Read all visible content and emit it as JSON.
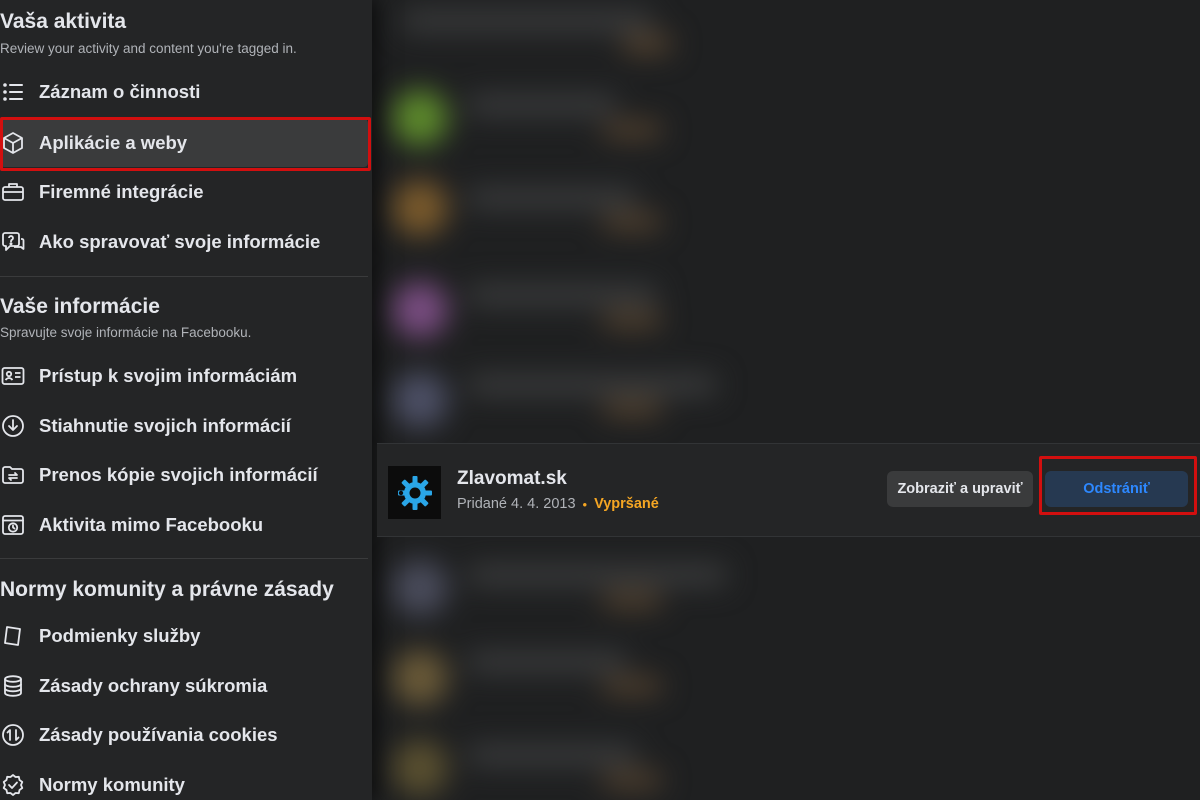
{
  "sidebar": {
    "activity": {
      "title": "Vaša aktivita",
      "subtitle": "Review your activity and content you're tagged in.",
      "items": [
        {
          "label": "Záznam o činnosti",
          "icon": "list-icon"
        },
        {
          "label": "Aplikácie a weby",
          "icon": "cube-icon",
          "selected": true
        },
        {
          "label": "Firemné integrácie",
          "icon": "briefcase-icon"
        },
        {
          "label": "Ako spravovať svoje informácie",
          "icon": "help-bubble-icon"
        }
      ]
    },
    "info": {
      "title": "Vaše informácie",
      "subtitle": "Spravujte svoje informácie na Facebooku.",
      "items": [
        {
          "label": "Prístup k svojim informáciám",
          "icon": "id-card-icon"
        },
        {
          "label": "Stiahnutie svojich informácií",
          "icon": "download-icon"
        },
        {
          "label": "Prenos kópie svojich informácií",
          "icon": "folder-transfer-icon"
        },
        {
          "label": "Aktivita mimo Facebooku",
          "icon": "history-window-icon"
        }
      ]
    },
    "community": {
      "title": "Normy komunity a právne zásady",
      "items": [
        {
          "label": "Podmienky služby",
          "icon": "document-icon"
        },
        {
          "label": "Zásady ochrany súkromia",
          "icon": "database-icon"
        },
        {
          "label": "Zásady používania cookies",
          "icon": "sync-arrows-icon"
        },
        {
          "label": "Normy komunity",
          "icon": "badge-check-icon"
        }
      ]
    }
  },
  "app": {
    "name": "Zlavomat.sk",
    "added": "Pridané 4. 4. 2013",
    "separator": "•",
    "status": "Vypršané",
    "view_label": "Zobraziť a upraviť",
    "remove_label": "Odstrániť"
  },
  "colors": {
    "background": "#242526",
    "highlight": "#d20f0f",
    "status": "#f5a623",
    "primary": "#2d88ff",
    "primary_bg": "#263951"
  }
}
